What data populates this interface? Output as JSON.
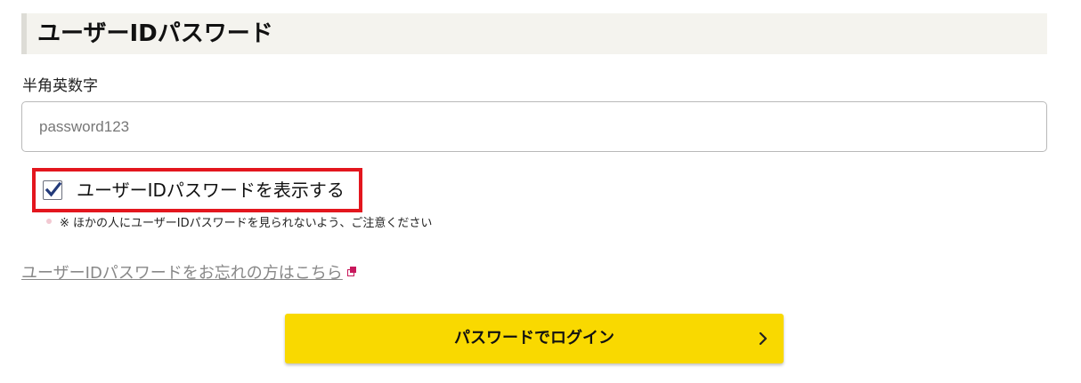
{
  "section": {
    "title": "ユーザーIDパスワード"
  },
  "password": {
    "label": "半角英数字",
    "value": "password123"
  },
  "show_toggle": {
    "label": "ユーザーIDパスワードを表示する",
    "checked": true
  },
  "note": {
    "text": "※ ほかの人にユーザーIDパスワードを見られないよう、ご注意ください"
  },
  "forgot_link": {
    "label": "ユーザーIDパスワードをお忘れの方はこちら"
  },
  "login_button": {
    "label": "パスワードでログイン"
  },
  "colors": {
    "accent_yellow": "#f9d900",
    "highlight_red": "#e3161e",
    "check_blue": "#233a7a",
    "link_icon": "#c8185c",
    "header_bg": "#f4f3ee"
  },
  "icons": {
    "checkbox": "checkmark-icon",
    "link": "external-link-icon",
    "button": "chevron-right-icon"
  }
}
